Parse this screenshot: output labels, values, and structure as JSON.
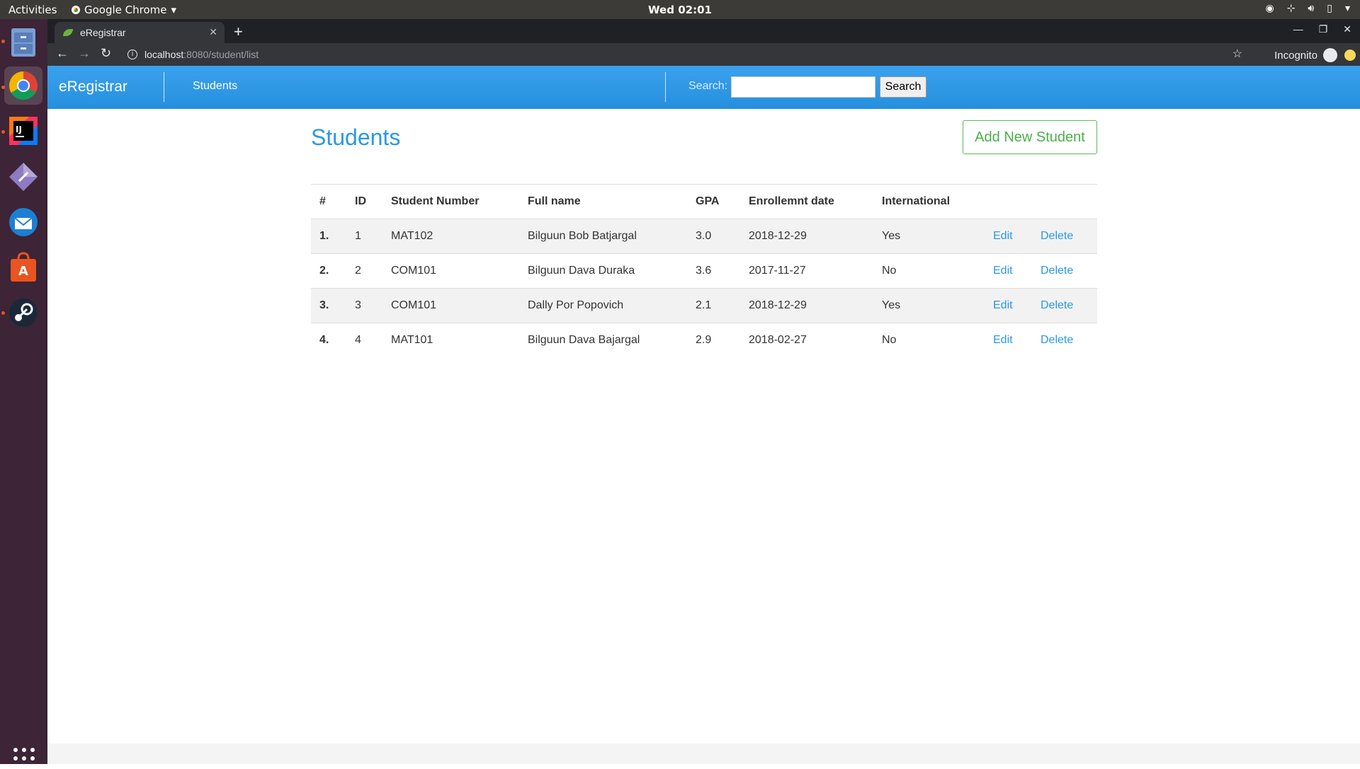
{
  "system": {
    "activities": "Activities",
    "app_menu": "Google Chrome",
    "clock": "Wed 02:01"
  },
  "browser": {
    "tab_title": "eRegistrar",
    "url_host": "localhost",
    "url_path": ":8080/student/list",
    "incognito_label": "Incognito"
  },
  "nav": {
    "brand": "eRegistrar",
    "students_link": "Students",
    "search_label": "Search:",
    "search_value": "",
    "search_button": "Search"
  },
  "main": {
    "title": "Students",
    "add_button": "Add New Student"
  },
  "table": {
    "headers": [
      "#",
      "ID",
      "Student Number",
      "Full name",
      "GPA",
      "Enrollemnt date",
      "International"
    ],
    "rows": [
      {
        "num": "1.",
        "id": "1",
        "student_number": "MAT102",
        "full_name": "Bilguun Bob Batjargal",
        "gpa": "3.0",
        "date": "2018-12-29",
        "international": "Yes",
        "edit": "Edit",
        "delete": "Delete"
      },
      {
        "num": "2.",
        "id": "2",
        "student_number": "COM101",
        "full_name": "Bilguun Dava Duraka",
        "gpa": "3.6",
        "date": "2017-11-27",
        "international": "No",
        "edit": "Edit",
        "delete": "Delete"
      },
      {
        "num": "3.",
        "id": "3",
        "student_number": "COM101",
        "full_name": "Dally Por Popovich",
        "gpa": "2.1",
        "date": "2018-12-29",
        "international": "Yes",
        "edit": "Edit",
        "delete": "Delete"
      },
      {
        "num": "4.",
        "id": "4",
        "student_number": "MAT101",
        "full_name": "Bilguun Dava Bajargal",
        "gpa": "2.9",
        "date": "2018-02-27",
        "international": "No",
        "edit": "Edit",
        "delete": "Delete"
      }
    ]
  },
  "colors": {
    "nav_blue": "#2b98e6",
    "add_green": "#4cae4c",
    "dock_bg": "#3d2437",
    "topbar_bg": "#3c3b37"
  }
}
